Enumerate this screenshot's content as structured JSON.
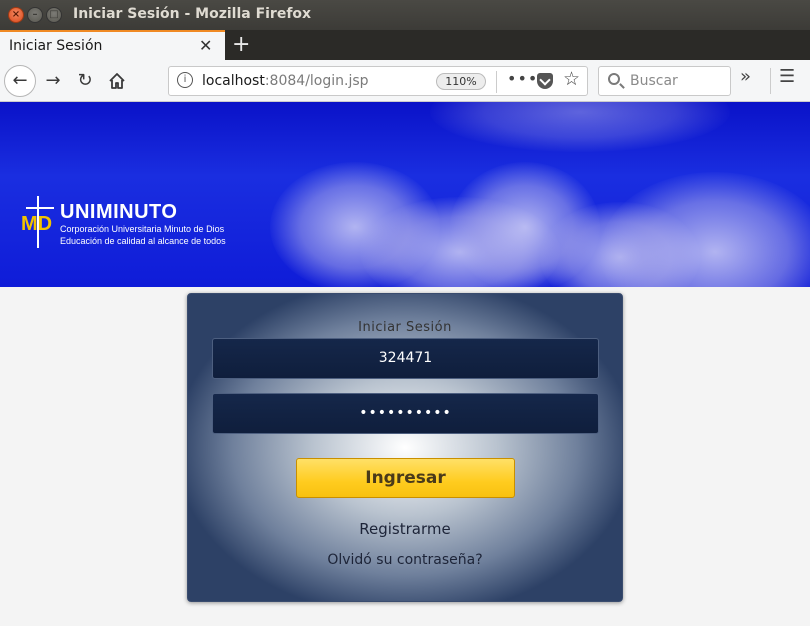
{
  "window": {
    "title": "Iniciar Sesión - Mozilla Firefox"
  },
  "tabs": [
    {
      "label": "Iniciar Sesión",
      "active": true
    }
  ],
  "toolbar": {
    "url_host": "localhost",
    "url_rest": ":8084/login.jsp",
    "zoom": "110%",
    "search_placeholder": "Buscar"
  },
  "banner": {
    "logo_mark": "MD",
    "logo_name": "UNIMINUTO",
    "logo_line1": "Corporación Universitaria Minuto de Dios",
    "logo_line2": "Educación de calidad al alcance de todos"
  },
  "login": {
    "title": "Iniciar Sesión",
    "username_value": "324471",
    "password_masked": "••••••••••",
    "submit_label": "Ingresar",
    "register_link": "Registrarme",
    "forgot_link": "Olvidó su contraseña?"
  },
  "colors": {
    "banner_blue": "#0f1cd8",
    "button_yellow": "#ffcc1f",
    "tab_accent": "#f08a24",
    "field_navy": "#15274a"
  }
}
